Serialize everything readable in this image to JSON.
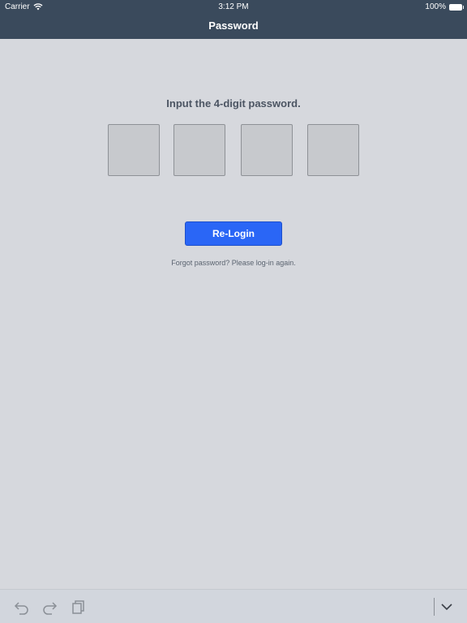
{
  "status_bar": {
    "carrier": "Carrier",
    "time": "3:12 PM",
    "battery": "100%"
  },
  "header": {
    "title": "Password"
  },
  "main": {
    "prompt": "Input the 4-digit password.",
    "digits": [
      "",
      "",
      "",
      ""
    ],
    "relogin_label": "Re-Login",
    "forgot_text": "Forgot password? Please log-in again."
  },
  "toolbar": {
    "icons": [
      "undo-icon",
      "redo-icon",
      "clipboard-icon",
      "chevron-down-icon"
    ]
  }
}
